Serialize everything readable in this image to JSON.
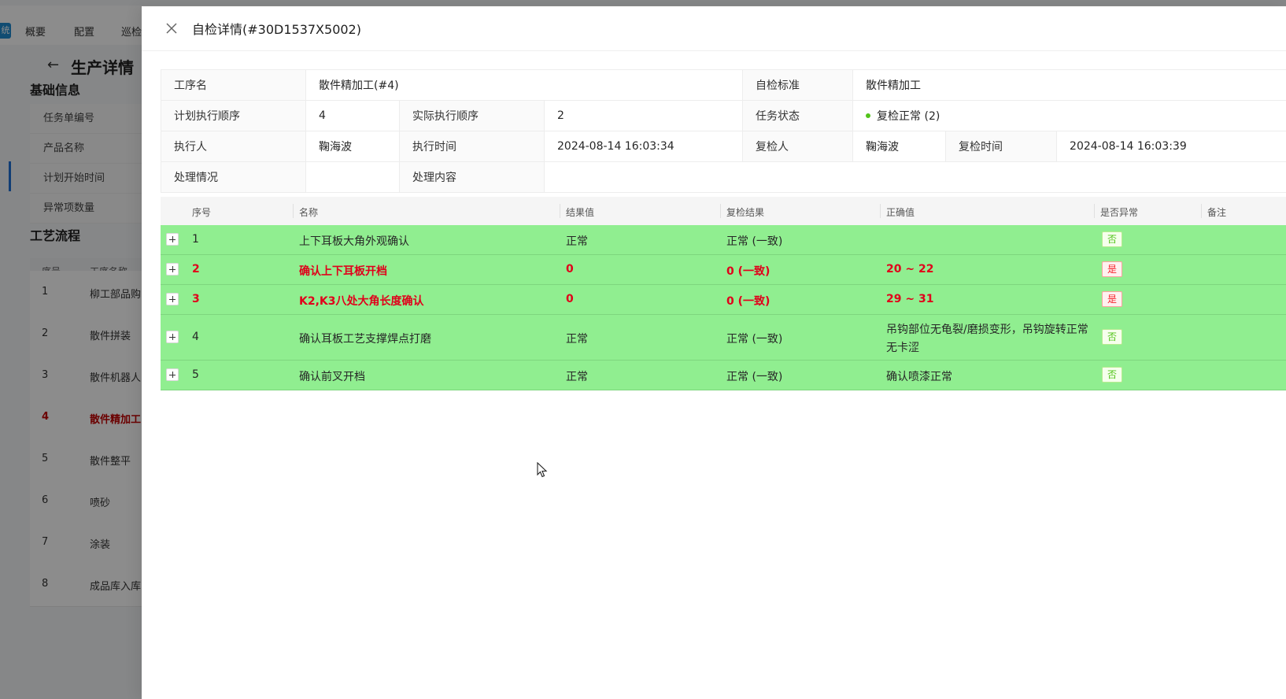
{
  "background": {
    "logo_text": "统",
    "nav": [
      "概要",
      "配置",
      "巡检"
    ],
    "page_title": "生产详情",
    "section_basic": "基础信息",
    "basic_labels": [
      "任务单编号",
      "产品名称",
      "计划开始时间",
      "异常项数量"
    ],
    "section_process": "工艺流程",
    "table_headers": [
      "序号",
      "工序名称"
    ],
    "rows": [
      {
        "no": "1",
        "name": "柳工部品购"
      },
      {
        "no": "2",
        "name": "散件拼装"
      },
      {
        "no": "3",
        "name": "散件机器人"
      },
      {
        "no": "4",
        "name": "散件精加工"
      },
      {
        "no": "5",
        "name": "散件整平"
      },
      {
        "no": "6",
        "name": "喷砂"
      },
      {
        "no": "7",
        "name": "涂装"
      },
      {
        "no": "8",
        "name": "成品库入库"
      }
    ]
  },
  "drawer": {
    "title": "自检详情(#30D1537X5002)",
    "info": {
      "process_name_label": "工序名",
      "process_name": "散件精加工(#4)",
      "standard_label": "自检标准",
      "standard": "散件精加工",
      "plan_order_label": "计划执行顺序",
      "plan_order": "4",
      "actual_order_label": "实际执行顺序",
      "actual_order": "2",
      "task_status_label": "任务状态",
      "task_status": "复检正常 (2)",
      "executor_label": "执行人",
      "executor": "鞠海波",
      "exec_time_label": "执行时间",
      "exec_time": "2024-08-14 16:03:34",
      "rechecker_label": "复检人",
      "rechecker": "鞠海波",
      "recheck_time_label": "复检时间",
      "recheck_time": "2024-08-14 16:03:39",
      "handling_label": "处理情况",
      "handling": "",
      "handling_content_label": "处理内容",
      "handling_content": ""
    },
    "table": {
      "headers": {
        "no": "序号",
        "name": "名称",
        "result": "结果值",
        "recheck": "复检结果",
        "correct": "正确值",
        "abnormal": "是否异常",
        "remark": "备注"
      },
      "rows": [
        {
          "no": "1",
          "name": "上下耳板大角外观确认",
          "result": "正常",
          "recheck": "正常 (一致)",
          "correct": "",
          "abnormal": "否"
        },
        {
          "no": "2",
          "name": "确认上下耳板开档",
          "result": "0",
          "recheck": "0 (一致)",
          "correct": "20 ~ 22",
          "abnormal": "是"
        },
        {
          "no": "3",
          "name": "K2,K3八处大角长度确认",
          "result": "0",
          "recheck": "0 (一致)",
          "correct": "29 ~ 31",
          "abnormal": "是"
        },
        {
          "no": "4",
          "name": "确认耳板工艺支撑焊点打磨",
          "result": "正常",
          "recheck": "正常 (一致)",
          "correct_line1": "吊钩部位无龟裂/磨损变形，吊钩旋转正常",
          "correct_line2": "无卡涩",
          "abnormal": "否"
        },
        {
          "no": "5",
          "name": "确认前叉开档",
          "result": "正常",
          "recheck": "正常 (一致)",
          "correct": "确认喷漆正常",
          "abnormal": "否"
        }
      ]
    }
  },
  "colors": {
    "row_highlight": "#90ee90",
    "error_text": "#e0001b",
    "status_dot": "#52c41a"
  }
}
